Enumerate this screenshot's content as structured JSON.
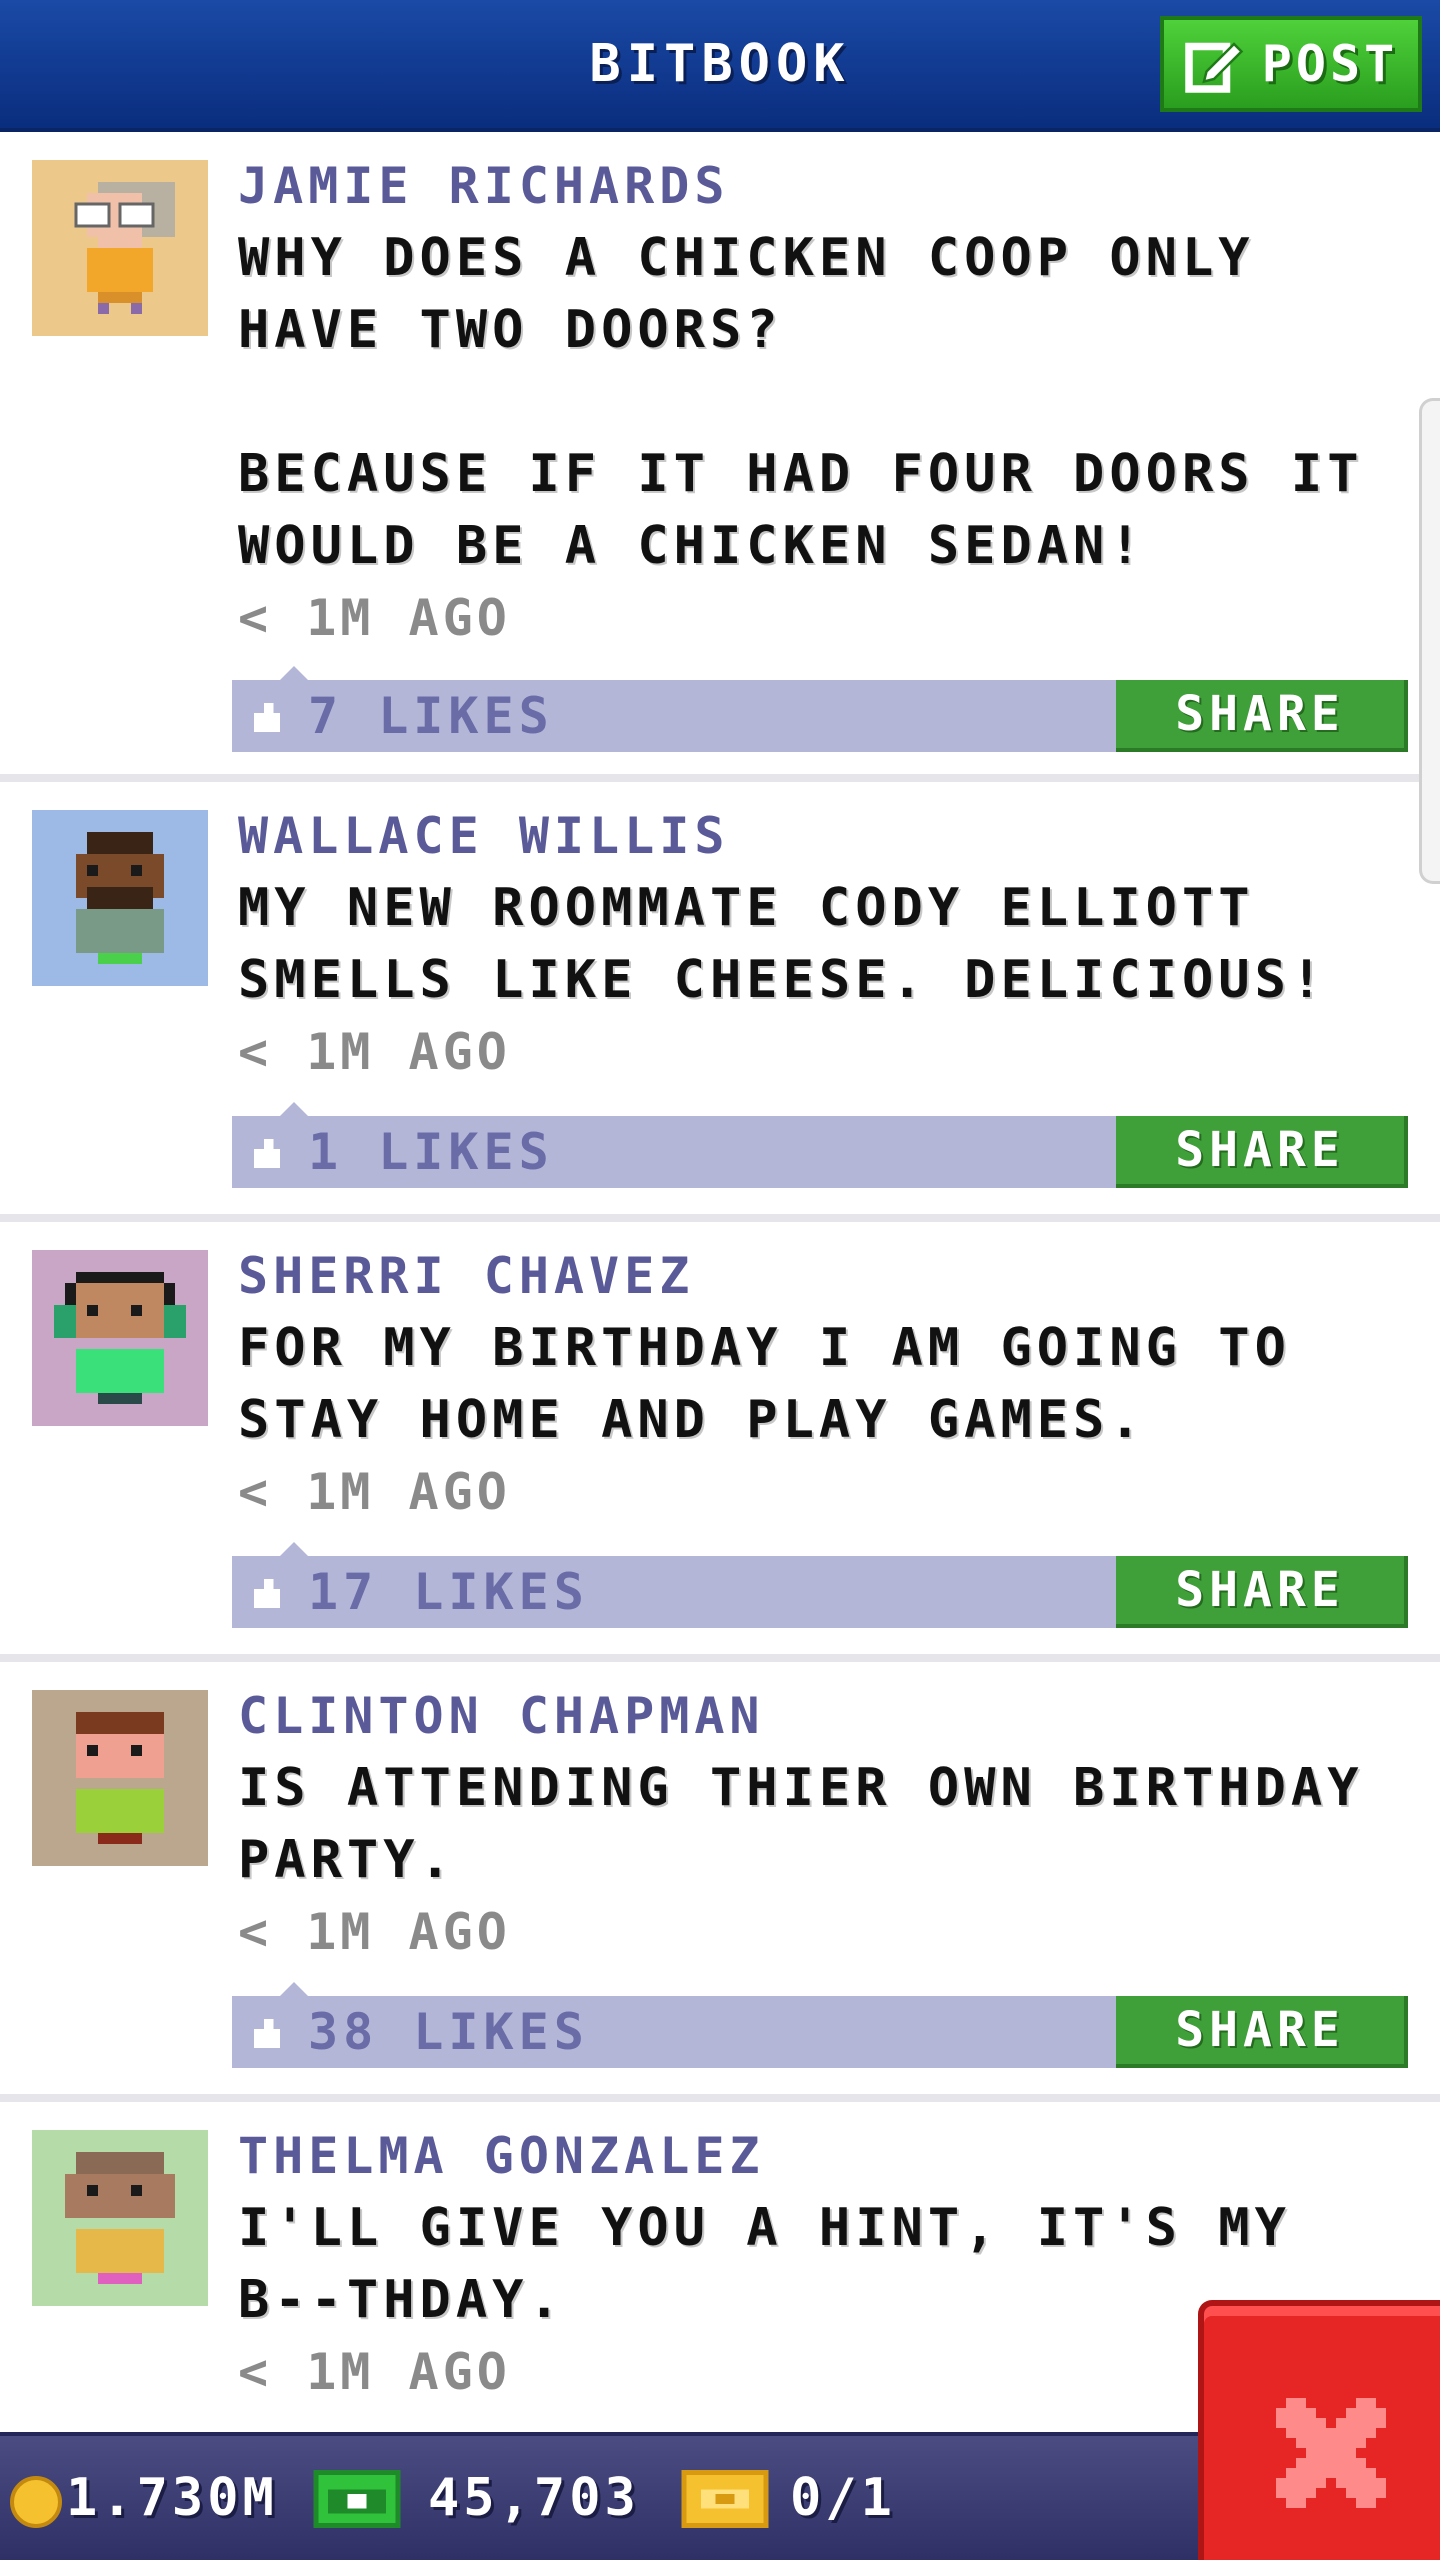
{
  "header": {
    "title": "BITBOOK",
    "post_label": "POST"
  },
  "posts": [
    {
      "author": "JAMIE RICHARDS",
      "message": "WHY DOES A CHICKEN COOP ONLY\nHAVE TWO DOORS?\n\nBECAUSE IF IT HAD FOUR DOORS IT\nWOULD BE A CHICKEN SEDAN!",
      "time": "< 1M AGO",
      "likes": "7 LIKES",
      "share_label": "SHARE",
      "avatar_bg": "#ecc98a"
    },
    {
      "author": "WALLACE WILLIS",
      "message": "MY NEW ROOMMATE CODY ELLIOTT\nSMELLS LIKE CHEESE. DELICIOUS!",
      "time": "< 1M AGO",
      "likes": "1 LIKES",
      "share_label": "SHARE",
      "avatar_bg": "#9db9e6"
    },
    {
      "author": "SHERRI CHAVEZ",
      "message": "FOR MY BIRTHDAY I AM GOING TO\nSTAY HOME AND PLAY GAMES.",
      "time": "< 1M AGO",
      "likes": "17 LIKES",
      "share_label": "SHARE",
      "avatar_bg": "#c9a6c6"
    },
    {
      "author": "CLINTON CHAPMAN",
      "message": "IS ATTENDING THIER OWN BIRTHDAY\nPARTY.",
      "time": "< 1M AGO",
      "likes": "38 LIKES",
      "share_label": "SHARE",
      "avatar_bg": "#bba68e"
    },
    {
      "author": "THELMA GONZALEZ",
      "message": "I'LL GIVE YOU A HINT, IT'S MY\nB--THDAY.",
      "time": "< 1M AGO",
      "avatar_bg": "#b5dca8"
    }
  ],
  "bottom_bar": {
    "coins": "1.730M",
    "bux": "45,703",
    "tickets": "0/1"
  },
  "colors": {
    "header": "#0a2d7e",
    "post_button": "#2a9e1f",
    "likes_bar": "#b4b6d8",
    "share_button": "#3f9f38",
    "close_button": "#e62525"
  },
  "icons": {
    "post": "compose-icon",
    "like": "thumbs-up-icon",
    "coin": "coin-icon",
    "cash": "bux-icon",
    "ticket": "ticket-icon",
    "close": "close-icon"
  }
}
